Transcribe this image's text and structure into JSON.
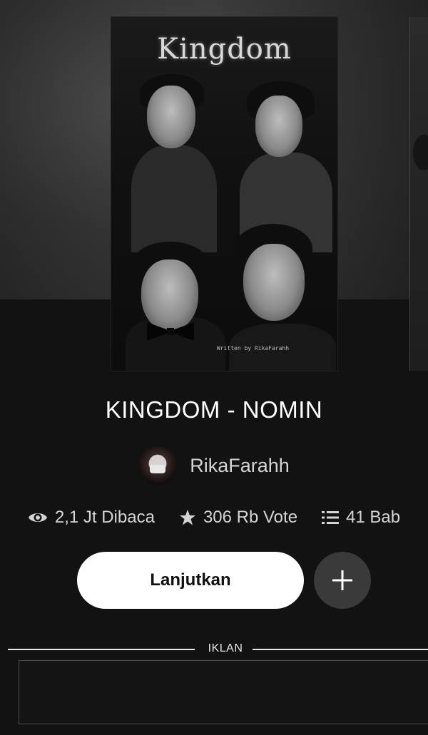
{
  "cover": {
    "title": "Kingdom",
    "credit": "Written by RikaFarahh"
  },
  "story": {
    "title": "KINGDOM - NOMIN"
  },
  "author": {
    "name": "RikaFarahh"
  },
  "stats": {
    "reads": "2,1 Jt Dibaca",
    "votes": "306 Rb Vote",
    "chapters": "41 Bab",
    "reads_icon": "eye-icon",
    "votes_icon": "star-icon",
    "chapters_icon": "list-icon"
  },
  "actions": {
    "continue_label": "Lanjutkan",
    "add_icon": "plus-icon"
  },
  "ad": {
    "label": "IKLAN"
  },
  "colors": {
    "background": "#121212",
    "primary_button": "#ffffff",
    "secondary_button": "#3a3a3a",
    "text": "#d4d4d4"
  }
}
